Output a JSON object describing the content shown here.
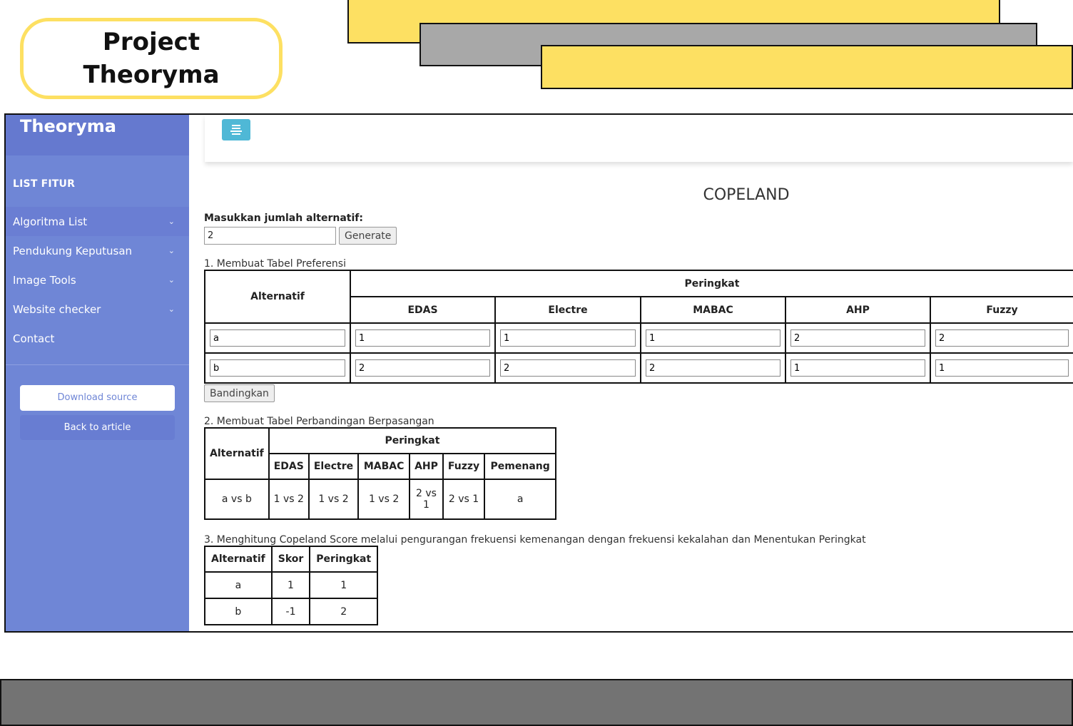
{
  "decor": {
    "line1": "Project",
    "line2": "Theoryma"
  },
  "sidebar": {
    "brand": "Theoryma",
    "list_title": "LIST FITUR",
    "items": [
      {
        "label": "Algoritma List",
        "has_chevron": true
      },
      {
        "label": "Pendukung Keputusan",
        "has_chevron": true
      },
      {
        "label": "Image Tools",
        "has_chevron": true
      },
      {
        "label": "Website checker",
        "has_chevron": true
      },
      {
        "label": "Contact",
        "has_chevron": false
      }
    ],
    "download_label": "Download source",
    "back_label": "Back to article"
  },
  "main": {
    "title": "COPELAND",
    "count_label": "Masukkan jumlah alternatif:",
    "count_value": "2",
    "generate_label": "Generate",
    "step1": "1. Membuat Tabel Preferensi",
    "table1": {
      "alt_header": "Alternatif",
      "group_header": "Peringkat",
      "methods": [
        "EDAS",
        "Electre",
        "MABAC",
        "AHP",
        "Fuzzy"
      ],
      "rows": [
        {
          "alt": "a",
          "values": [
            "1",
            "1",
            "1",
            "2",
            "2"
          ]
        },
        {
          "alt": "b",
          "values": [
            "2",
            "2",
            "2",
            "1",
            "1"
          ]
        }
      ]
    },
    "compare_label": "Bandingkan",
    "step2": "2. Membuat Tabel Perbandingan Berpasangan",
    "table2": {
      "alt_header": "Alternatif",
      "group_header": "Peringkat",
      "cols": [
        "EDAS",
        "Electre",
        "MABAC",
        "AHP",
        "Fuzzy",
        "Pemenang"
      ],
      "row": [
        "a vs b",
        "1 vs 2",
        "1 vs 2",
        "1 vs 2",
        "2 vs 1",
        "2 vs 1",
        "a"
      ]
    },
    "step3": "3. Menghitung Copeland Score melalui pengurangan frekuensi kemenangan dengan frekuensi kekalahan dan Menentukan Peringkat",
    "table3": {
      "headers": [
        "Alternatif",
        "Skor",
        "Peringkat"
      ],
      "rows": [
        [
          "a",
          "1",
          "1"
        ],
        [
          "b",
          "-1",
          "2"
        ]
      ]
    }
  },
  "colors": {
    "sidebar": "#6f86d6",
    "accent_yellow": "#fde062",
    "toggle": "#4fb8d6",
    "deco_gray": "#a8a8a8",
    "bottom_gray": "#737373"
  }
}
